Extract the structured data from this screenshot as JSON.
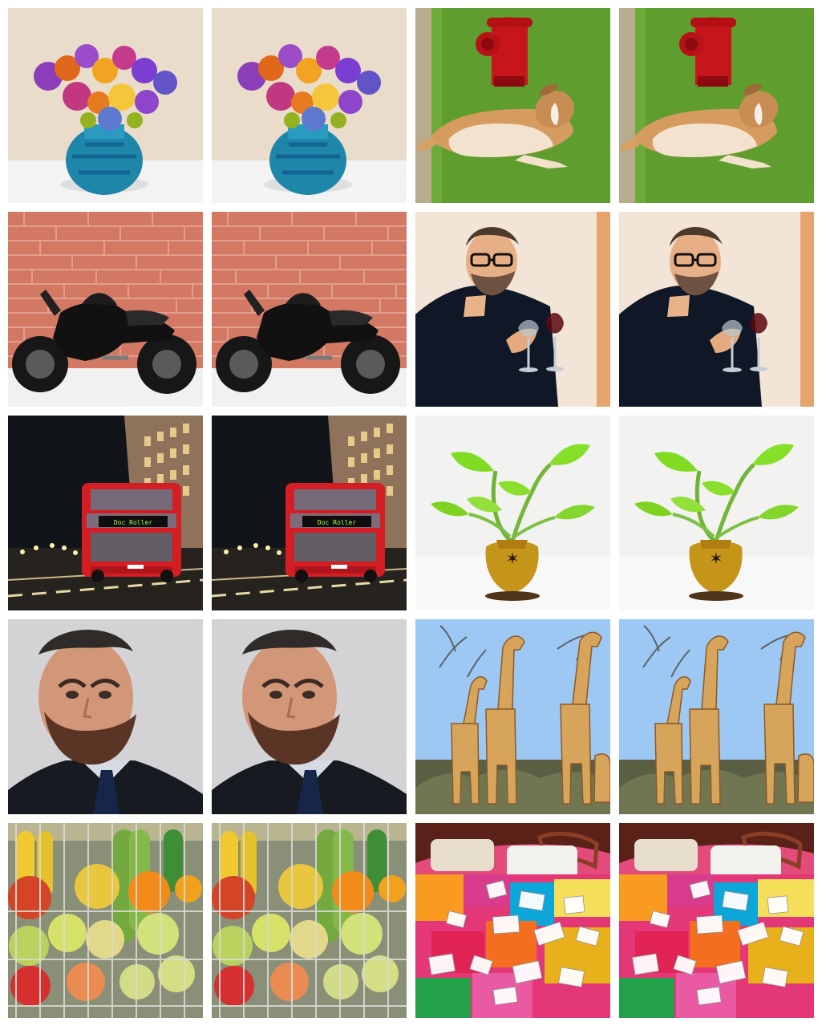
{
  "grid": {
    "rows": 5,
    "columns": 4,
    "tiles": [
      {
        "row": 1,
        "col": 1,
        "scene": "flower-vase",
        "icon": "flower-vase-icon",
        "background": "#E8DCCD"
      },
      {
        "row": 1,
        "col": 2,
        "scene": "flower-vase",
        "icon": "flower-vase-icon",
        "background": "#E8DCCD"
      },
      {
        "row": 1,
        "col": 3,
        "scene": "dog-hydrant",
        "icon": "dog-hydrant-icon",
        "background": "#5E9D2E"
      },
      {
        "row": 1,
        "col": 4,
        "scene": "dog-hydrant",
        "icon": "dog-hydrant-icon",
        "background": "#5E9D2E"
      },
      {
        "row": 2,
        "col": 1,
        "scene": "motorcycle-brick",
        "icon": "motorcycle-icon",
        "background": "#D47A63"
      },
      {
        "row": 2,
        "col": 2,
        "scene": "motorcycle-brick",
        "icon": "motorcycle-icon",
        "background": "#D47A63"
      },
      {
        "row": 2,
        "col": 3,
        "scene": "man-wine",
        "icon": "man-wine-icon",
        "background": "#F1E3D6"
      },
      {
        "row": 2,
        "col": 4,
        "scene": "man-wine",
        "icon": "man-wine-icon",
        "background": "#F1E3D6"
      },
      {
        "row": 3,
        "col": 1,
        "scene": "night-bus",
        "icon": "bus-icon",
        "background": "#101317",
        "sign_text": "Doc Roller"
      },
      {
        "row": 3,
        "col": 2,
        "scene": "night-bus",
        "icon": "bus-icon",
        "background": "#101317",
        "sign_text": "Doc Roller"
      },
      {
        "row": 3,
        "col": 3,
        "scene": "plant-vase",
        "icon": "plant-vase-icon",
        "background": "#F2F2F0"
      },
      {
        "row": 3,
        "col": 4,
        "scene": "plant-vase",
        "icon": "plant-vase-icon",
        "background": "#F2F2F0"
      },
      {
        "row": 4,
        "col": 1,
        "scene": "bearded-man",
        "icon": "portrait-icon",
        "background": "#D3D3D5"
      },
      {
        "row": 4,
        "col": 2,
        "scene": "bearded-man",
        "icon": "portrait-icon",
        "background": "#D3D3D5"
      },
      {
        "row": 4,
        "col": 3,
        "scene": "giraffes",
        "icon": "giraffes-icon",
        "background": "#9CC8F3"
      },
      {
        "row": 4,
        "col": 4,
        "scene": "giraffes",
        "icon": "giraffes-icon",
        "background": "#9CC8F3"
      },
      {
        "row": 5,
        "col": 1,
        "scene": "fruit-basket",
        "icon": "fruit-basket-icon",
        "background": "#8A8F77"
      },
      {
        "row": 5,
        "col": 2,
        "scene": "fruit-basket",
        "icon": "fruit-basket-icon",
        "background": "#8A8F77"
      },
      {
        "row": 5,
        "col": 3,
        "scene": "messy-bed",
        "icon": "messy-bed-icon",
        "background": "#E34B7A"
      },
      {
        "row": 5,
        "col": 4,
        "scene": "messy-bed",
        "icon": "messy-bed-icon",
        "background": "#E34B7A"
      }
    ]
  }
}
